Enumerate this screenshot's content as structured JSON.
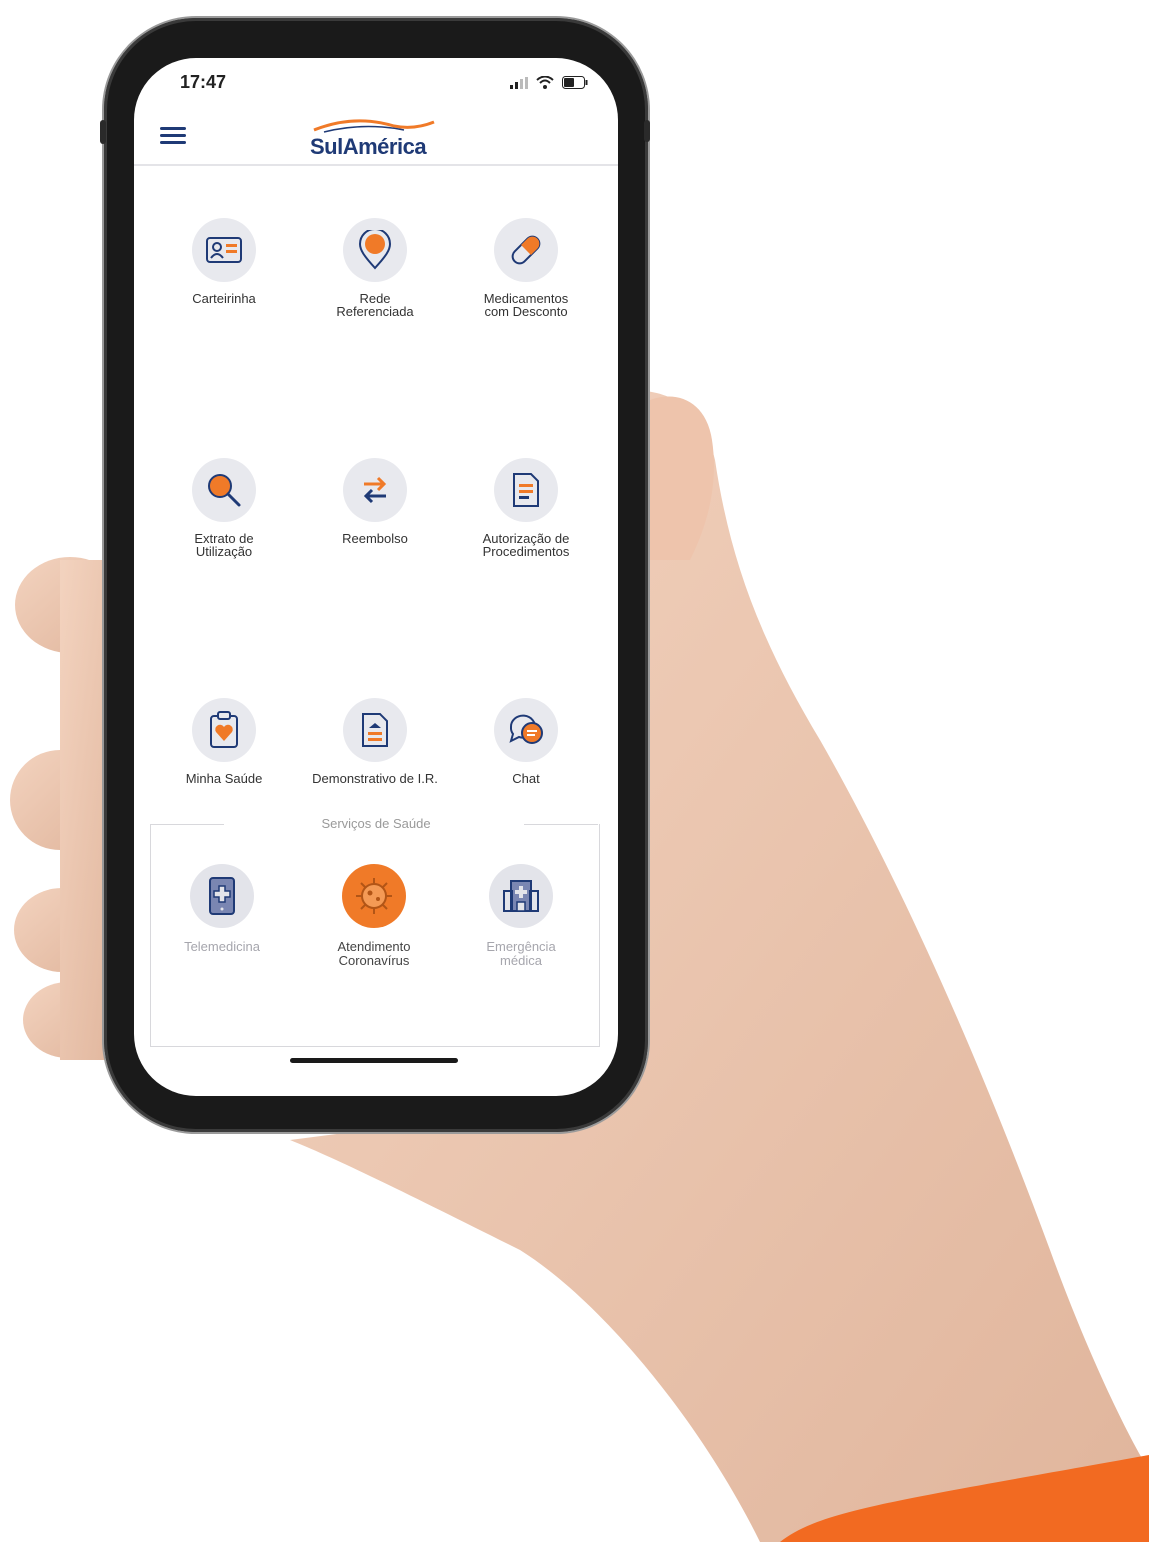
{
  "status_bar": {
    "time": "17:47"
  },
  "header": {
    "logo_text": "SulAmérica"
  },
  "menu_items": [
    {
      "label": "Carteirinha",
      "icon": "id-card-icon"
    },
    {
      "label": "Rede\nReferenciada",
      "icon": "location-pin-icon"
    },
    {
      "label": "Medicamentos\ncom Desconto",
      "icon": "pill-icon"
    },
    {
      "label": "Extrato de\nUtilização",
      "icon": "magnifier-icon"
    },
    {
      "label": "Reembolso",
      "icon": "exchange-arrows-icon"
    },
    {
      "label": "Autorização de\nProcedimentos",
      "icon": "document-icon"
    },
    {
      "label": "Minha Saúde",
      "icon": "clipboard-heart-icon"
    },
    {
      "label": "Demonstrativo de I.R.",
      "icon": "report-document-icon"
    },
    {
      "label": "Chat",
      "icon": "chat-bubbles-icon"
    }
  ],
  "services": {
    "title": "Serviços de Saúde",
    "items": [
      {
        "label": "Telemedicina",
        "icon": "tablet-cross-icon",
        "state": "disabled"
      },
      {
        "label": "Atendimento\nCoronavírus",
        "icon": "virus-icon",
        "state": "active"
      },
      {
        "label": "Emergência\nmédica",
        "icon": "hospital-icon",
        "state": "disabled"
      }
    ]
  },
  "colors": {
    "brand_blue": "#1f3a76",
    "accent_orange": "#f07a28",
    "icon_bg": "#e8e9ee",
    "muted_text": "#a6a6ad"
  }
}
